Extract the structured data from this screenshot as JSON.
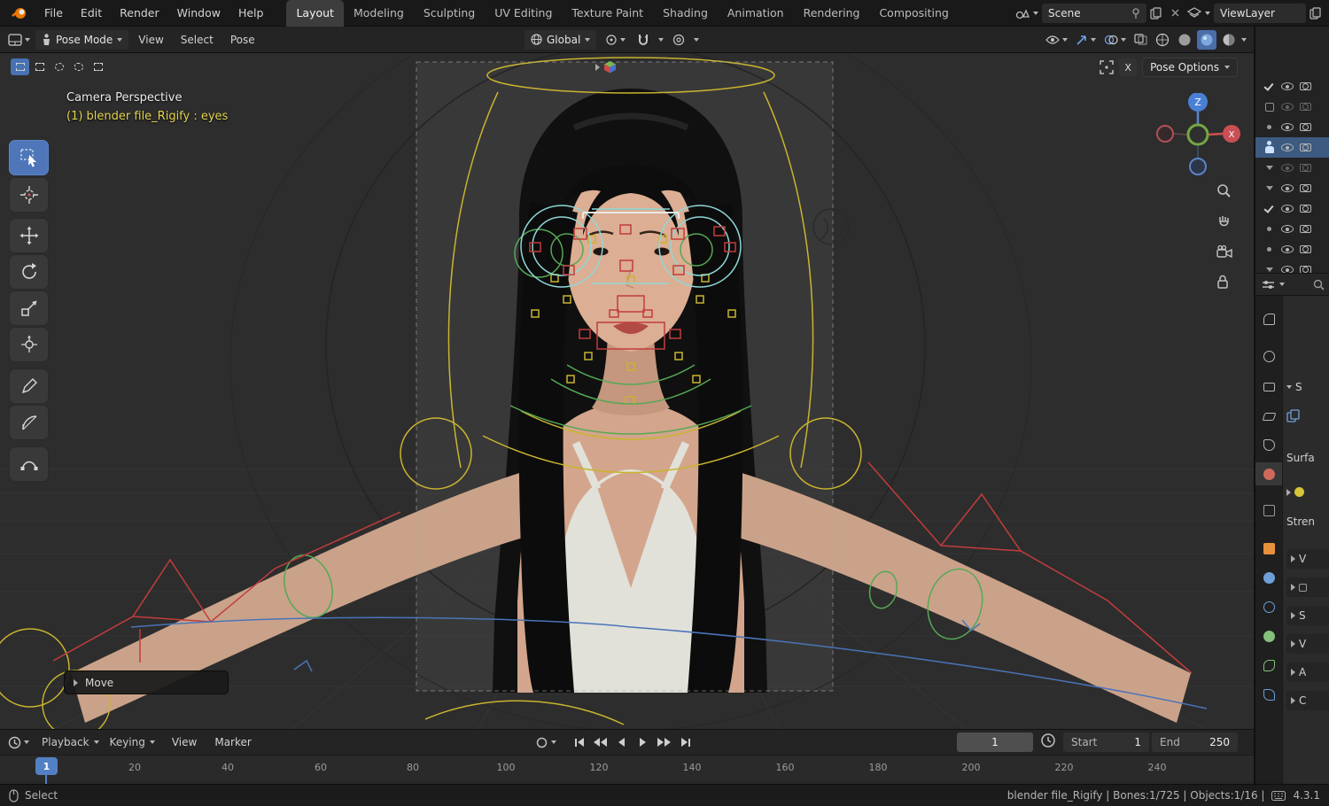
{
  "topbar": {
    "menus": [
      "File",
      "Edit",
      "Render",
      "Window",
      "Help"
    ],
    "workspaces": [
      "Layout",
      "Modeling",
      "Sculpting",
      "UV Editing",
      "Texture Paint",
      "Shading",
      "Animation",
      "Rendering",
      "Compositing"
    ],
    "active_workspace": "Layout",
    "scene_value": "Scene",
    "viewlayer_value": "ViewLayer"
  },
  "header": {
    "mode": "Pose Mode",
    "menus": [
      "View",
      "Select",
      "Pose"
    ],
    "orientation": "Global",
    "pose_options_label": "Pose Options",
    "close_label": "X"
  },
  "viewport": {
    "view_label": "Camera Perspective",
    "object_label": "(1) blender file_Rigify : eyes",
    "operator_label": "Move",
    "gizmo": {
      "z": "Z",
      "x": "X"
    }
  },
  "timeline": {
    "playback_label": "Playback",
    "keying_label": "Keying",
    "view_label": "View",
    "marker_label": "Marker",
    "current_frame": "1",
    "start_label": "Start",
    "start_value": "1",
    "end_label": "End",
    "end_value": "250",
    "playhead_label": "1",
    "ticks": [
      "20",
      "40",
      "60",
      "80",
      "100",
      "120",
      "140",
      "160",
      "180",
      "200",
      "220",
      "240"
    ]
  },
  "statusbar": {
    "left_label": "Select",
    "info": "blender file_Rigify | Bones:1/725 | Objects:1/16 |",
    "version": "4.3.1"
  },
  "properties": {
    "section_s": "S",
    "surface_label": "Surfa",
    "strength_label": "Stren",
    "collapsed_sections": [
      "V",
      "S",
      "V",
      "A",
      "C"
    ]
  },
  "colors": {
    "accent": "#4772b3",
    "object_label_yellow": "#e3d44f",
    "axis_x": "#cf4f55",
    "axis_y": "#74a742",
    "axis_z": "#4a7fd6",
    "rig_yellow": "#c9b42f",
    "rig_green": "#55a855",
    "rig_cyan": "#8fd8d8",
    "rig_red": "#c23c3c",
    "selection_row": "#3d5a80"
  },
  "icons": [
    "blender-logo",
    "editor-type",
    "pose-mode-person",
    "orientation-globe",
    "pivot-point",
    "snap-magnet",
    "proportional-editing",
    "visibility-eye",
    "gizmo-arrow",
    "overlays",
    "xray-toggle",
    "shading-wireframe",
    "shading-solid",
    "shading-material",
    "shading-rendered",
    "select-box",
    "cursor",
    "move",
    "rotate",
    "scale",
    "transform",
    "annotate",
    "measure",
    "extra-tool",
    "zoom",
    "pan-hand",
    "camera-view",
    "lock",
    "nav-gizmo",
    "auto-key-record",
    "jump-start",
    "prev-keyframe",
    "play-backward",
    "play-forward",
    "next-keyframe",
    "jump-end",
    "clock",
    "mouse",
    "keymap",
    "eye",
    "camera-restrict",
    "checkbox",
    "armature-person",
    "pin",
    "copy-pages",
    "frame-brackets",
    "cube",
    "magnifier"
  ]
}
